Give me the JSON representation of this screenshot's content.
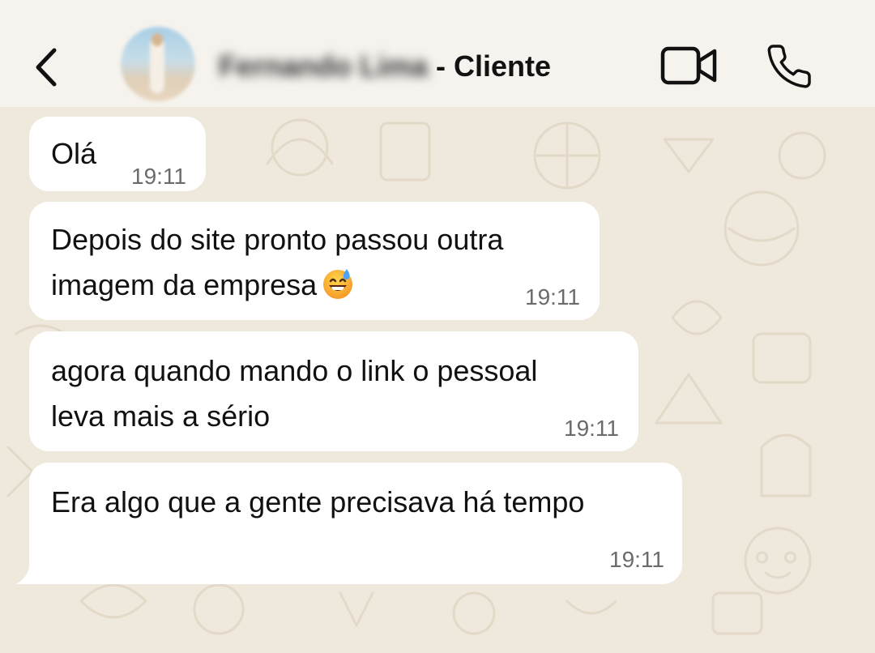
{
  "header": {
    "contact_name_hidden": "Fernando Lima",
    "contact_name_suffix": " - Cliente"
  },
  "messages": [
    {
      "lines": [
        "Olá"
      ],
      "time": "19:11"
    },
    {
      "lines": [
        "Depois do site pronto passou outra",
        "imagem da empresa"
      ],
      "emoji": "grinning-face-with-sweat-icon",
      "time": "19:11"
    },
    {
      "lines": [
        "agora quando mando o link o pessoal",
        "leva mais a sério"
      ],
      "time": "19:11"
    },
    {
      "lines": [
        "Era algo que a gente precisava há tempo"
      ],
      "time": "19:11"
    }
  ],
  "colors": {
    "header_bg": "#f6f3ee",
    "chat_bg": "#efe8dc",
    "bubble_bg": "#ffffff",
    "timestamp": "#6b6b6b"
  }
}
